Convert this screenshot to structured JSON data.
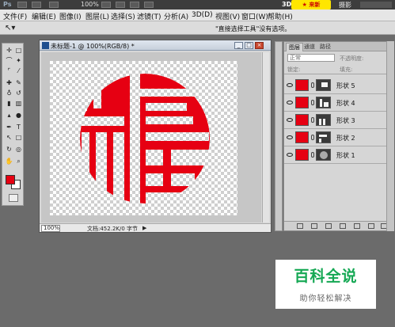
{
  "titlebar": {
    "app_icon": "Ps",
    "zoom": "100%",
    "mode_3d": "3D",
    "badge": "★ 来新",
    "workspace": "摄影"
  },
  "menubar": {
    "items": [
      "文件(F)",
      "编辑(E)",
      "图像(I)",
      "图层(L)",
      "选择(S)",
      "滤镜(T)",
      "分析(A)",
      "3D(D)",
      "视图(V)",
      "窗口(W)",
      "帮助(H)"
    ]
  },
  "options_bar": {
    "tool_icon": "path-selection-arrow-icon",
    "hint": "\"直接选择工具\"没有选项。"
  },
  "colors": {
    "foreground": "#e60012",
    "background": "#ffffff",
    "shape_fill": "#e60012"
  },
  "document": {
    "title": "未标题-1 @ 100%(RGB/8) *",
    "zoom_field": "100%",
    "info": "文档:452.2K/0 字节",
    "artwork": "fu-character-red-seal"
  },
  "layers_panel": {
    "tabs": [
      "图层",
      "通道",
      "路径"
    ],
    "blend_mode": "正常",
    "opacity_label": "不透明度:",
    "lock_label": "锁定:",
    "fill_label": "填充:",
    "layers": [
      {
        "name": "形状 5"
      },
      {
        "name": "形状 4"
      },
      {
        "name": "形状 3"
      },
      {
        "name": "形状 2"
      },
      {
        "name": "形状 1"
      }
    ]
  },
  "watermark": {
    "main": "百科全说",
    "sub": "助你轻松解决"
  }
}
